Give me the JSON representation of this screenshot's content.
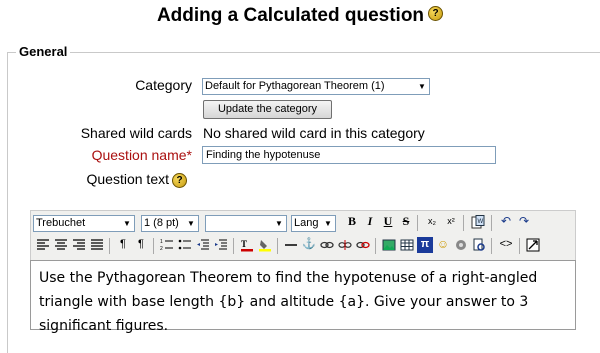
{
  "page_title": "Adding a Calculated question",
  "section": {
    "legend": "General"
  },
  "form": {
    "category_label": "Category",
    "category_value": "Default for Pythagorean Theorem (1)",
    "update_button": "Update the category",
    "shared_label": "Shared wild cards",
    "shared_value": "No shared wild card in this category",
    "name_label": "Question name",
    "name_required_mark": "*",
    "name_value": "Finding the hypotenuse",
    "text_label": "Question text"
  },
  "editor": {
    "font_family": "Trebuchet",
    "font_size": "1 (8 pt)",
    "format": "",
    "lang": "Lang",
    "content": "Use the Pythagorean Theorem to find the hypotenuse of a right-angled triangle with base length {b} and altitude {a}. Give your answer to 3 significant figures."
  },
  "icons": {
    "help": "help-icon",
    "bold": "B",
    "italic": "I",
    "underline": "U",
    "strike": "S",
    "subscript": "x₂",
    "superscript": "x²"
  },
  "colors": {
    "required": "#aa1010",
    "toolbar_bg": "#f0f0ee"
  }
}
